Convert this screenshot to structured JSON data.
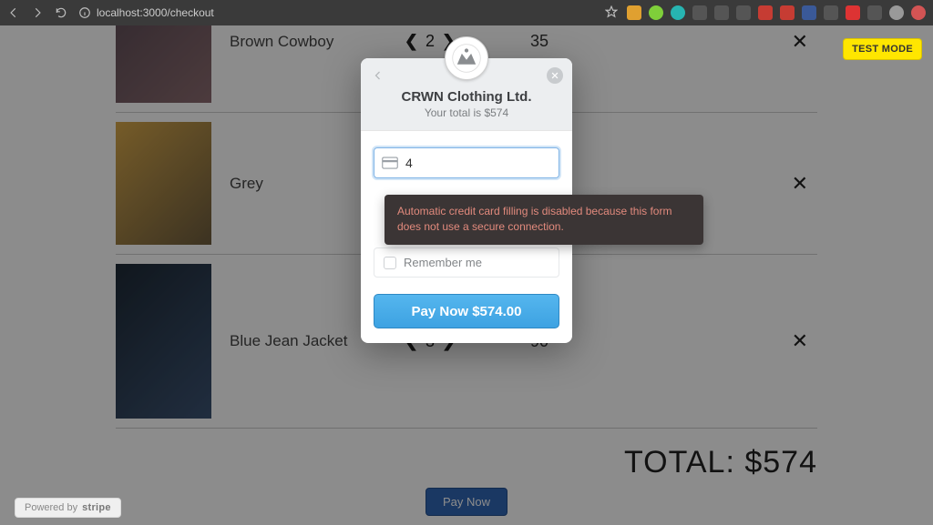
{
  "browser": {
    "url": "localhost:3000/checkout"
  },
  "checkout": {
    "items": [
      {
        "name": "Brown Cowboy",
        "qty": "2",
        "price": "35"
      },
      {
        "name": "Grey",
        "qty": "",
        "price": ""
      },
      {
        "name": "Blue Jean Jacket",
        "qty": "3",
        "price": "90"
      }
    ],
    "total_label": "TOTAL: $574",
    "pay_now_btn": "Pay Now"
  },
  "test_mode_label": "TEST MODE",
  "modal": {
    "title": "CRWN Clothing Ltd.",
    "subtitle": "Your total is $574",
    "card_value": "4",
    "remember_label": "Remember me",
    "pay_button": "Pay Now $574.00"
  },
  "warning": "Automatic credit card filling is disabled because this form does not use a secure connection.",
  "powered": {
    "prefix": "Powered by",
    "brand": "stripe"
  },
  "glyphs": {
    "arrow_left": "❮",
    "arrow_right": "❯",
    "remove": "✕"
  }
}
